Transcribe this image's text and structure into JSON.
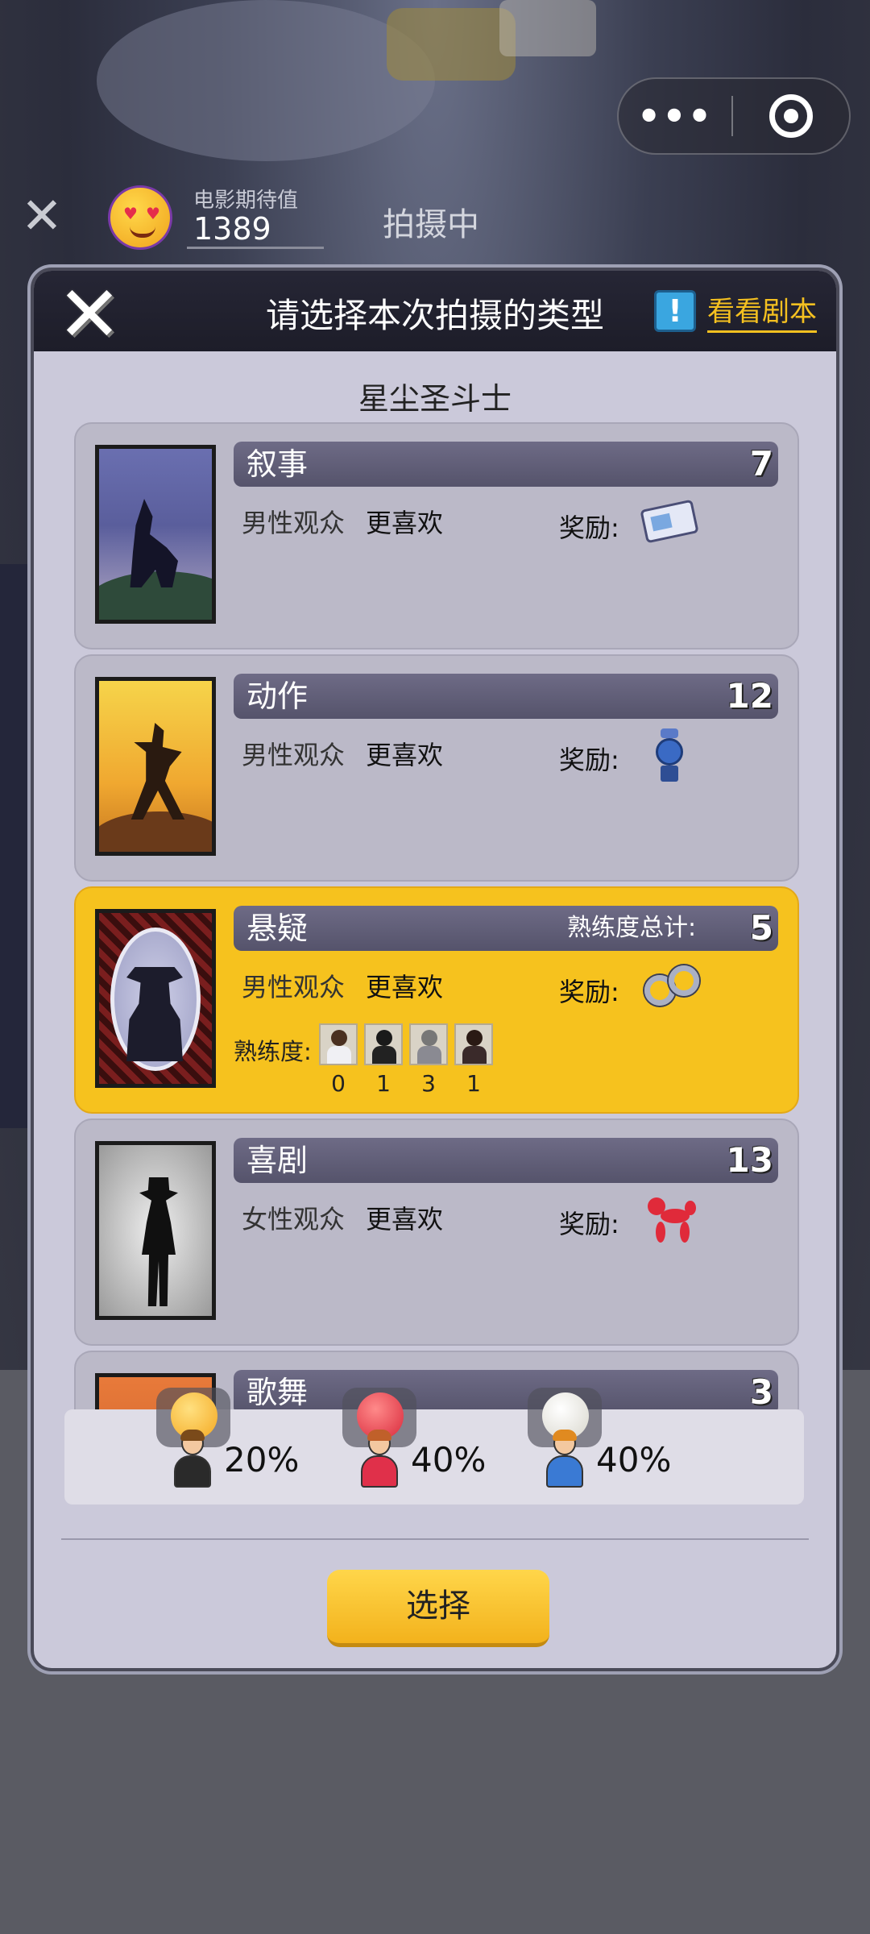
{
  "capsule": {
    "more_icon": "more-dots-icon",
    "close_icon": "target-circle-icon"
  },
  "topbar": {
    "expect_label": "电影期待值",
    "expect_value": "1389",
    "status": "拍摄中"
  },
  "dialog": {
    "title": "请选择本次拍摄的类型",
    "script_button": "看看剧本",
    "movie_name": "星尘圣斗士",
    "reward_label": "奖励:",
    "mastery_label": "熟练度:",
    "select_button": "选择"
  },
  "genres": [
    {
      "name": "叙事",
      "count": "7",
      "audience": "男性观众",
      "preference": "更喜欢",
      "reward_icon": "ticket-icon"
    },
    {
      "name": "动作",
      "count": "12",
      "audience": "男性观众",
      "preference": "更喜欢",
      "reward_icon": "fan-icon"
    },
    {
      "name": "悬疑",
      "count": "5",
      "audience": "男性观众",
      "preference": "更喜欢",
      "reward_icon": "handcuffs-icon",
      "mastery_total_label": "熟练度总计:",
      "mastery_values": [
        "0",
        "1",
        "3",
        "1"
      ],
      "selected": true
    },
    {
      "name": "喜剧",
      "count": "13",
      "audience": "女性观众",
      "preference": "更喜欢",
      "reward_icon": "balloon-dog-icon"
    },
    {
      "name": "歌舞",
      "count": "3"
    }
  ],
  "audience_breakdown": [
    {
      "percent": "20%",
      "mood_icon": "laughing-face-icon",
      "person_icon": "man-in-suit-icon"
    },
    {
      "percent": "40%",
      "mood_icon": "angry-face-icon",
      "person_icon": "woman-icon"
    },
    {
      "percent": "40%",
      "mood_icon": "neutral-face-icon",
      "person_icon": "young-man-icon"
    }
  ],
  "colors": {
    "accent": "#f6c21e",
    "link": "#f4c020"
  }
}
